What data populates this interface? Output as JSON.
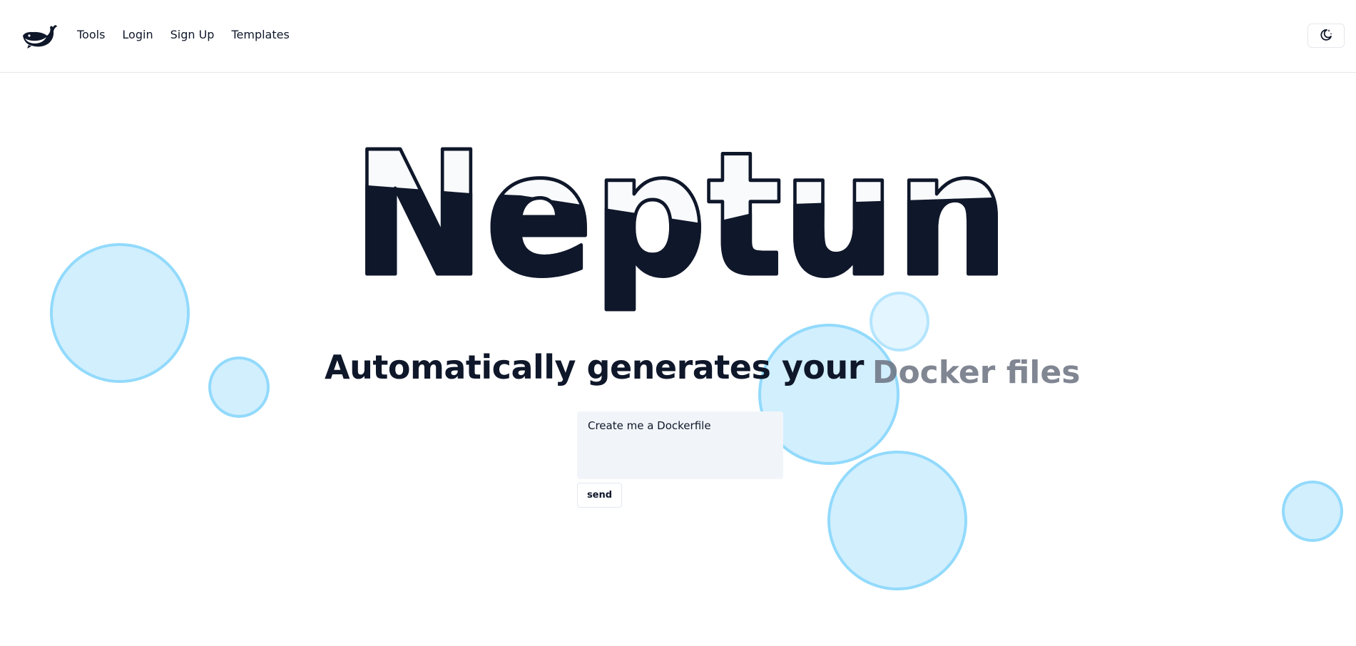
{
  "header": {
    "logo_icon": "whale-logo-icon",
    "nav": {
      "tools": "Tools",
      "login": "Login",
      "signup": "Sign Up",
      "templates": "Templates"
    },
    "theme_toggle_icon": "moon-stars-icon"
  },
  "hero": {
    "title": "Neptun",
    "subtitle_static": "Automatically generates your",
    "subtitle_animated": "Docker files"
  },
  "prompt": {
    "value": "Create me a Dockerfile",
    "send_label": "send"
  },
  "colors": {
    "text": "#0f172a",
    "bubble_fill": "#bae6fd",
    "bubble_border": "#7dd3fc",
    "input_bg": "#f1f5f9",
    "animated_text": "#6b7280"
  }
}
